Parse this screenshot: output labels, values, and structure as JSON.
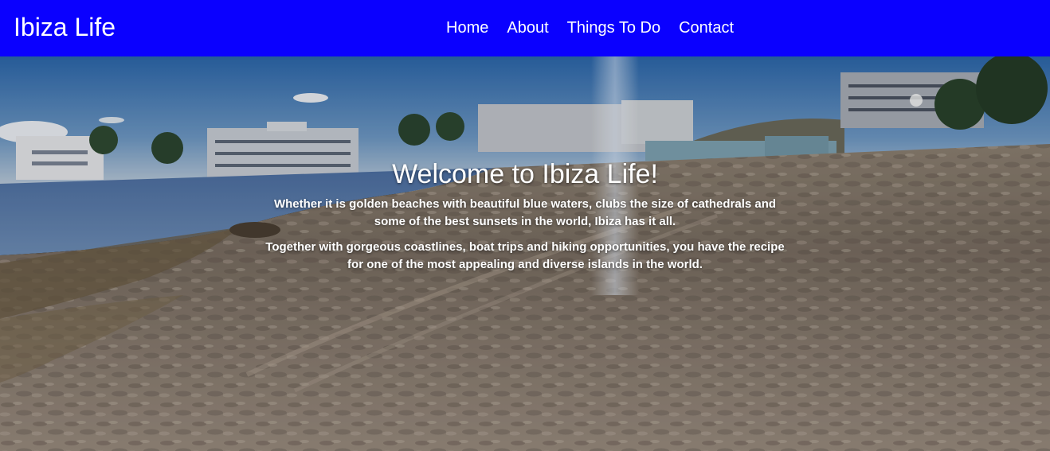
{
  "header": {
    "brand": "Ibiza Life",
    "nav": [
      "Home",
      "About",
      "Things To Do",
      "Contact"
    ]
  },
  "hero": {
    "title": "Welcome to Ibiza Life!",
    "paragraphs": [
      "Whether it is golden beaches with beautiful blue waters, clubs the size of cathedrals and some of the best sunsets in the world, Ibiza has it all.",
      "Together with gorgeous coastlines, boat trips and hiking opportunities, you have the recipe for one of the most appealing and diverse islands in the world."
    ],
    "background_description_icon": "beach-photo"
  },
  "colors": {
    "navbar": "#0a00ff",
    "text": "#ffffff"
  }
}
